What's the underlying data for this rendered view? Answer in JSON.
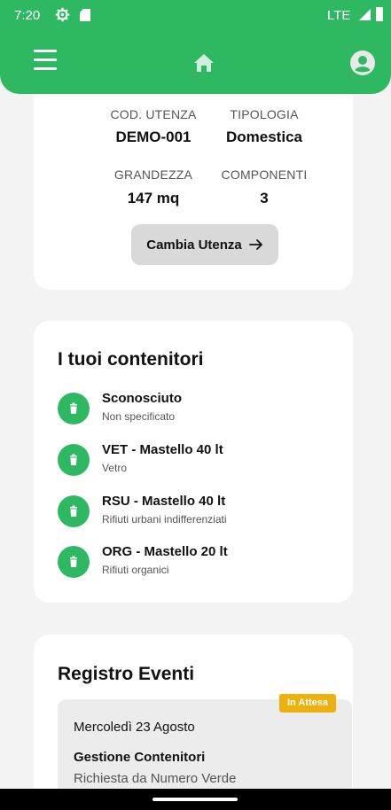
{
  "status_bar": {
    "time": "7:20",
    "network": "LTE",
    "icons": [
      "gear-icon",
      "sd-card-icon",
      "signal-icon",
      "battery-icon"
    ]
  },
  "app_bar": {
    "left_icon": "menu-icon",
    "center_icon": "home-icon",
    "right_icon": "account-icon"
  },
  "user_card": {
    "fields": [
      {
        "label": "COD. UTENZA",
        "value": "DEMO-001"
      },
      {
        "label": "TIPOLOGIA",
        "value": "Domestica"
      },
      {
        "label": "GRANDEZZA",
        "value": "147 mq"
      },
      {
        "label": "COMPONENTI",
        "value": "3"
      }
    ],
    "change_button": "Cambia Utenza"
  },
  "containers_card": {
    "title": "I tuoi contenitori",
    "items": [
      {
        "name": "Sconosciuto",
        "description": "Non specificato"
      },
      {
        "name": "VET - Mastello 40 lt",
        "description": "Vetro"
      },
      {
        "name": "RSU - Mastello 40 lt",
        "description": "Rifiuti urbani indifferenziati"
      },
      {
        "name": "ORG - Mastello 20 lt",
        "description": "Rifiuti organici"
      }
    ]
  },
  "events_card": {
    "title": "Registro Eventi",
    "events": [
      {
        "status": "In Attesa",
        "date": "Mercoledì 23 Agosto",
        "type": "Gestione Contenitori",
        "origin": "Richiesta da Numero Verde"
      }
    ]
  },
  "colors": {
    "brand_green": "#2fb862",
    "badge_amber": "#ecb10c",
    "background": "#f3f3f3"
  }
}
